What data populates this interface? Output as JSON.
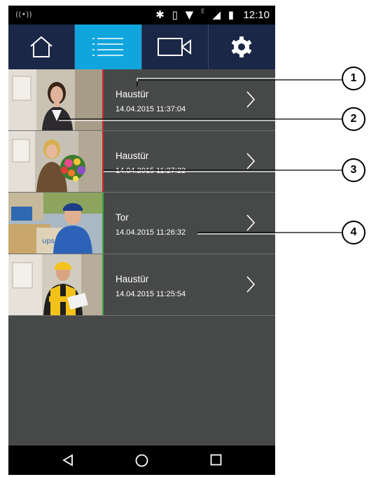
{
  "status_bar": {
    "cast": "((•))",
    "icons": "✱ ▯ ▼",
    "net_label": "E",
    "signal_battery": "◢ ▮",
    "time": "12:10"
  },
  "tabs": [
    {
      "icon": "home-icon",
      "active": false
    },
    {
      "icon": "list-icon",
      "active": true
    },
    {
      "icon": "video-camera-icon",
      "active": false
    },
    {
      "icon": "gear-icon",
      "active": false
    }
  ],
  "events": [
    {
      "title": "Haustür",
      "timestamp": "14.04.2015 11:37:04",
      "marker_color": "#d0262b",
      "photo": "woman in business suit"
    },
    {
      "title": "Haustür",
      "timestamp": "14.04.2015 11:27:22",
      "marker_color": "#d0262b",
      "photo": "person holding flower bouquet"
    },
    {
      "title": "Tor",
      "timestamp": "14.04.2015 11:26:32",
      "marker_color": "#3aa645",
      "photo": "delivery man with packages"
    },
    {
      "title": "Haustür",
      "timestamp": "14.04.2015 11:25:54",
      "marker_color": "#3aa645",
      "photo": "courier in yellow jacket"
    }
  ],
  "nav": [
    "back-icon",
    "home-circle-icon",
    "recents-icon"
  ],
  "callouts": [
    "1",
    "2",
    "3",
    "4"
  ],
  "colors": {
    "tab_bar": "#1b2746",
    "tab_active": "#10a5dc",
    "list_background": "#474848",
    "marker_red": "#d0262b",
    "marker_green": "#3aa645"
  }
}
